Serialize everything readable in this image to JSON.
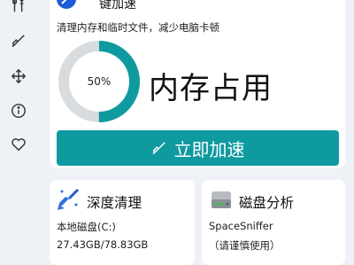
{
  "header": {
    "title_fragment": "键加速",
    "subtitle": "清理内存和临时文件，减少电脑卡顿"
  },
  "sidebar": {
    "items": [
      {
        "icon": "tools-icon"
      },
      {
        "icon": "broom-icon"
      },
      {
        "icon": "move-icon"
      },
      {
        "icon": "info-icon"
      },
      {
        "icon": "heart-icon"
      }
    ]
  },
  "memory": {
    "percent_label": "50%",
    "usage_fraction": 0.5,
    "label": "内存占用"
  },
  "accelerate_button": {
    "label": "立即加速"
  },
  "deep_clean": {
    "title": "深度清理",
    "drive": "本地磁盘(C:)",
    "usage": "27.43GB/78.83GB"
  },
  "disk_analysis": {
    "title": "磁盘分析",
    "tool": "SpaceSniffer",
    "note": "（请谨慎使用）"
  },
  "colors": {
    "accent": "#0f9aa0",
    "gauge_track": "#d9dcdf",
    "background": "#eef2f6",
    "card": "#ffffff"
  }
}
